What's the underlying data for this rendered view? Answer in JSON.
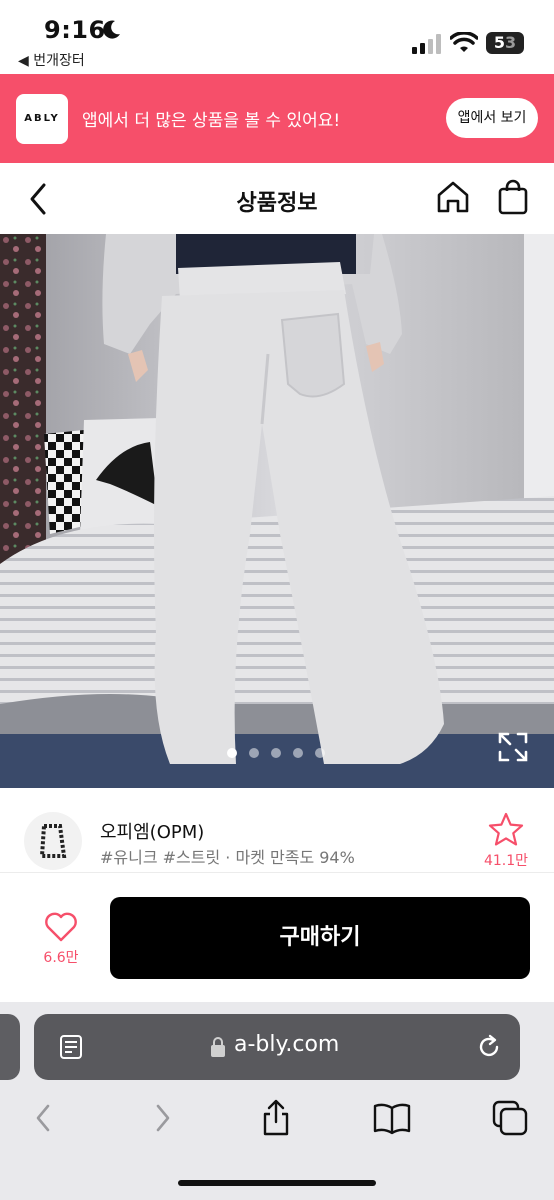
{
  "status_bar": {
    "time": "9:16",
    "back_app": "◀ 번개장터",
    "battery_main": "5",
    "battery_dim": "3"
  },
  "promo": {
    "logo": "ABLY",
    "text": "앱에서 더 많은 상품을 볼 수 있어요!",
    "button": "앱에서 보기",
    "color": "#f64f6a"
  },
  "header": {
    "title": "상품정보",
    "icons": [
      "chevron-left-icon",
      "home-icon",
      "shopping-bag-icon"
    ]
  },
  "product_image": {
    "description_icon": "image-expand-icon",
    "carousel_total": 5,
    "carousel_active": 1
  },
  "seller": {
    "name": "오피엠(OPM)",
    "tags": "#유니크 #스트릿 · 마켓 만족도 94%",
    "favorites": "41.1만"
  },
  "buy_bar": {
    "likes": "6.6만",
    "buy_label": "구매하기"
  },
  "browser": {
    "url": "a-bly.com"
  }
}
